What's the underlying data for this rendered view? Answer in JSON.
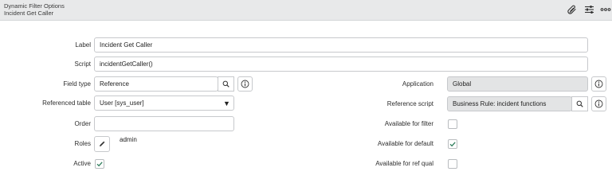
{
  "header": {
    "title": "Dynamic Filter Options",
    "subtitle": "Incident Get Caller",
    "icons": [
      "paperclip-icon",
      "settings-sliders-icon",
      "more-options-icon"
    ]
  },
  "form": {
    "label": {
      "label": "Label",
      "value": "Incident Get Caller"
    },
    "script": {
      "label": "Script",
      "value": "incidentGetCaller()"
    },
    "field_type": {
      "label": "Field type",
      "value": "Reference"
    },
    "referenced_table": {
      "label": "Referenced table",
      "value": "User [sys_user]"
    },
    "order": {
      "label": "Order",
      "value": ""
    },
    "roles": {
      "label": "Roles",
      "value": "admin"
    },
    "active": {
      "label": "Active",
      "checked": true
    },
    "application": {
      "label": "Application",
      "value": "Global"
    },
    "reference_script": {
      "label": "Reference script",
      "value": "Business Rule: incident functions"
    },
    "available_for_filter": {
      "label": "Available for filter",
      "checked": false
    },
    "available_for_default": {
      "label": "Available for default",
      "checked": true
    },
    "available_for_ref_qual": {
      "label": "Available for ref qual",
      "checked": false
    }
  },
  "colors": {
    "header_bg": "#e8e9ea",
    "readonly_bg": "#e3e4e5",
    "check_color": "#2e7d5b"
  }
}
